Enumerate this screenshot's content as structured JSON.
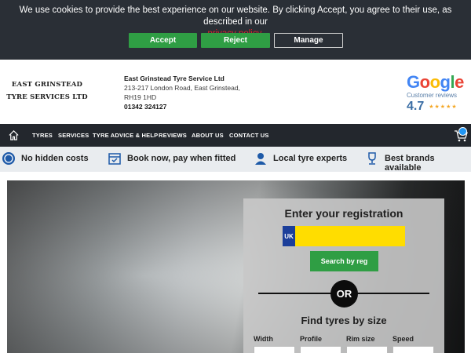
{
  "cookie": {
    "text": "We use cookies to provide the best experience on our website. By clicking Accept, you agree to their use, as described in our",
    "link_text": "privacy policy",
    "link_suffix": ".",
    "accept_label": "Accept",
    "reject_label": "Reject",
    "manage_label": "Manage"
  },
  "header": {
    "logo_line1": "EAST GRINSTEAD",
    "logo_line2": "TYRE SERVICES LTD",
    "business_name": "East Grinstead Tyre Service Ltd",
    "address_line1": "213-217 London Road, East Grinstead,",
    "address_line2": "RH19 1HD",
    "phone": "01342 324127",
    "google_word": "Google",
    "google_sub": "Customer reviews",
    "google_rating": "4.7",
    "google_stars": "★★★★★"
  },
  "nav": {
    "home_icon": "home-icon",
    "items": [
      "TYRES",
      "SERVICES",
      "TYRE ADVICE & HELP",
      "REVIEWS",
      "ABOUT US",
      "CONTACT US"
    ],
    "cart_icon": "cart-icon"
  },
  "usp": {
    "items": [
      {
        "label": "No hidden costs",
        "icon": "coin-icon"
      },
      {
        "label": "Book now, pay when fitted",
        "icon": "calendar-icon"
      },
      {
        "label": "Local tyre experts",
        "icon": "person-icon"
      },
      {
        "label": "Best brands available",
        "icon": "trophy-icon"
      }
    ]
  },
  "hero": {
    "reg_title": "Enter your registration",
    "uk_label": "UK",
    "reg_value": "",
    "search_label": "Search by reg",
    "or_label": "OR",
    "size_title": "Find tyres by size",
    "size_labels": [
      "Width",
      "Profile",
      "Rim size",
      "Speed"
    ]
  },
  "colors": {
    "accent_green": "#2f9e44",
    "dark_bar": "#23272d",
    "cookie_bg": "#2a2f36",
    "reg_yellow": "#ffdd00",
    "uk_blue": "#1b3e9a",
    "link_red": "#d9272e"
  }
}
